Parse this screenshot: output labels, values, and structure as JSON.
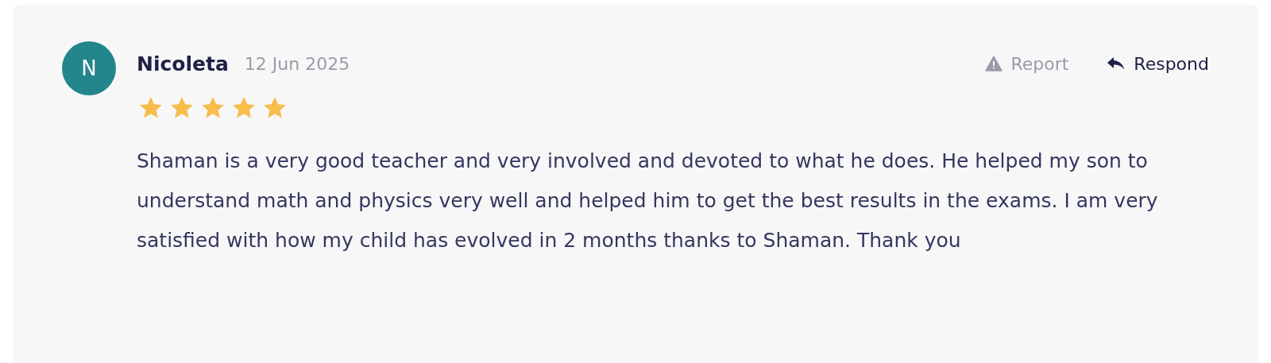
{
  "review": {
    "avatar": {
      "initial": "N",
      "color": "#23868d"
    },
    "author": "Nicoleta",
    "date": "12 Jun 2025",
    "stars": 5,
    "actions": [
      {
        "kind": "report",
        "label": "Report"
      },
      {
        "kind": "respond",
        "label": "Respond"
      }
    ],
    "text": "Shaman is a very good teacher and very involved and devoted to what he does. He helped my son to understand math and physics very well and helped him to get the best results in the exams. I am very satisfied with how my child has evolved in 2 months thanks to Shaman. Thank you"
  }
}
